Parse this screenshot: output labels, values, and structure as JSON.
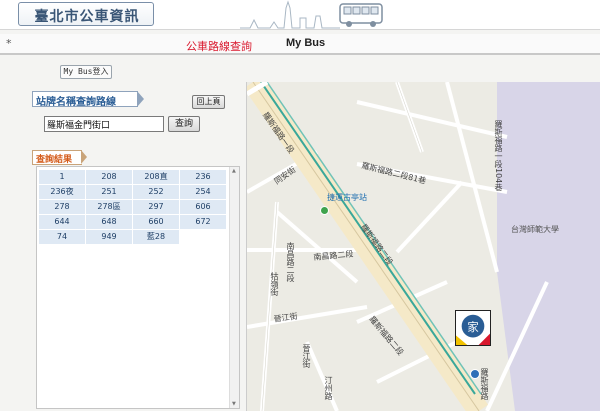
{
  "header": {
    "site_title": "臺北市公車資訊"
  },
  "nav": {
    "star": "*",
    "route_query": "公車路線查詢",
    "my_bus": "My Bus"
  },
  "mybus_login": "My Bus登入",
  "search": {
    "label": "站牌名稱查詢路線",
    "back_label": "回上頁",
    "input_value": "羅斯福金門街口",
    "query_label": "查詢"
  },
  "results": {
    "label": "查詢結果",
    "routes": [
      "1",
      "208",
      "208直",
      "236",
      "236夜",
      "251",
      "252",
      "254",
      "278",
      "278區",
      "297",
      "606",
      "644",
      "648",
      "660",
      "672",
      "74",
      "949",
      "藍28"
    ]
  },
  "map": {
    "labels": [
      "羅斯福路一段",
      "羅斯福路一段104巷",
      "羅斯福路二段81巷",
      "羅斯福路二段",
      "捷運古亭站",
      "南昌路二段",
      "南昌路二段",
      "同安街",
      "牯嶺街",
      "台灣師範大學",
      "晉江街",
      "羅斯福路二段",
      "晉江街",
      "汀州路",
      "羅斯福路"
    ],
    "logo_text": "家"
  },
  "colors": {
    "brand_blue": "#2a5d95",
    "route_red": "#d9182d",
    "result_orange": "#d45b1a",
    "mrt_line": "#3aa89a",
    "campus": "#d8d5e8"
  }
}
